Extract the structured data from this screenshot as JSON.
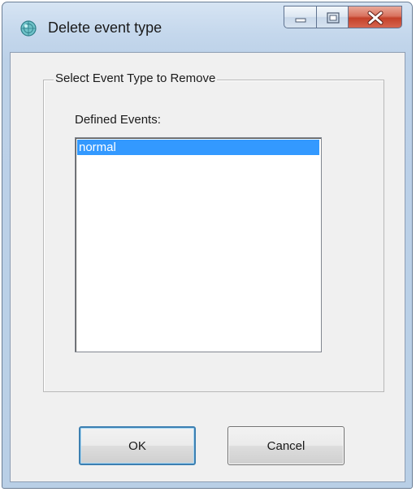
{
  "window": {
    "title": "Delete event type",
    "icon": "globe-app-icon",
    "caption_buttons": {
      "minimize_icon": "minimize-icon",
      "maximize_icon": "maximize-icon",
      "close_icon": "close-icon",
      "close_color": "#c4412a"
    }
  },
  "group": {
    "title": "Select Event Type to Remove"
  },
  "list": {
    "label": "Defined Events:",
    "items": [
      {
        "label": "normal",
        "selected": true
      }
    ],
    "selection_color": "#3399ff"
  },
  "buttons": {
    "ok_label": "OK",
    "cancel_label": "Cancel"
  }
}
